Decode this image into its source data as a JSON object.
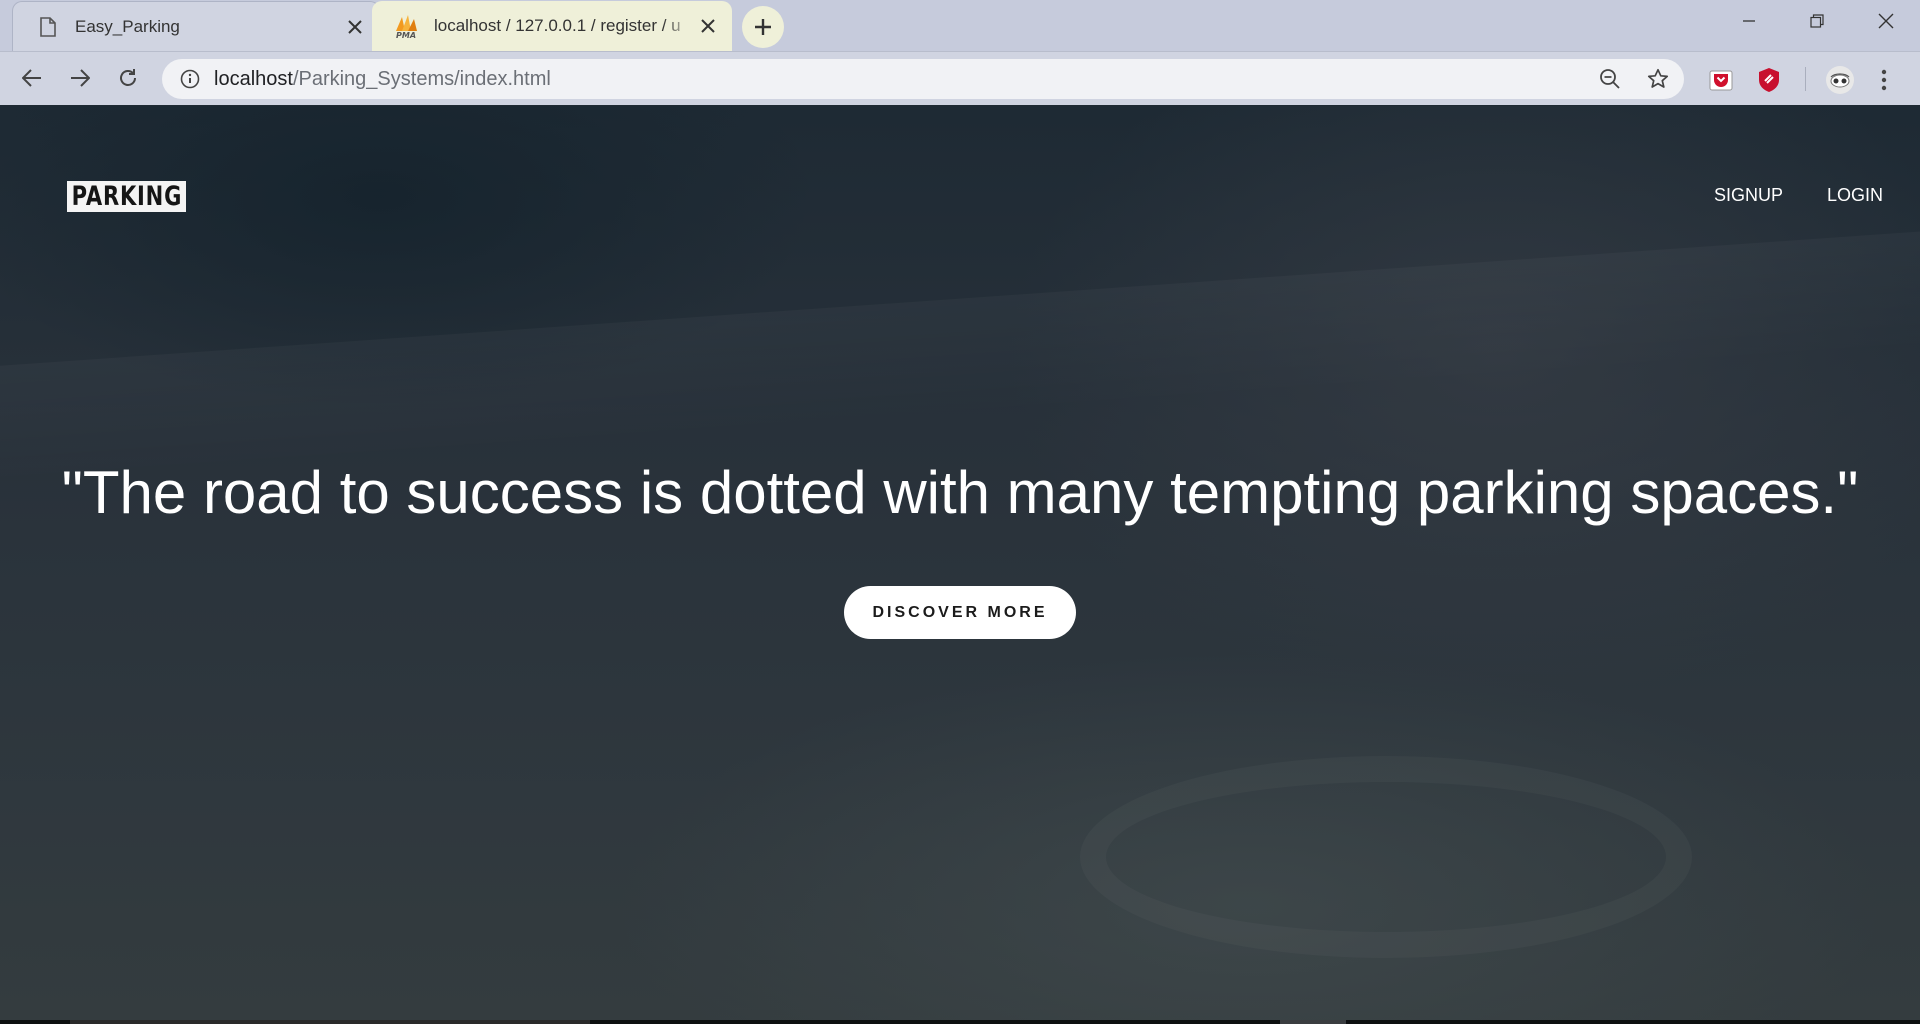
{
  "browser": {
    "tabs": [
      {
        "title": "Easy_Parking",
        "icon": "page-icon",
        "active": true
      },
      {
        "title": "localhost / 127.0.0.1 / register / u",
        "icon": "phpmyadmin-icon",
        "active": false
      }
    ],
    "address_bar": {
      "host": "localhost",
      "path": "/Parking_Systems/index.html"
    }
  },
  "site": {
    "logo_text": "PARKING",
    "nav": [
      {
        "label": "SIGNUP"
      },
      {
        "label": "LOGIN"
      }
    ],
    "hero": {
      "quote": "\"The road to success is dotted with many tempting parking spaces.\"",
      "cta_label": "DISCOVER MORE"
    }
  },
  "colors": {
    "chrome_bg": "#c6cbdc",
    "toolbar_bg": "#d0d4e1",
    "inactive_tab_bg": "#eff0d9",
    "hero_overlay": "#1f2a33",
    "text_white": "#ffffff"
  }
}
